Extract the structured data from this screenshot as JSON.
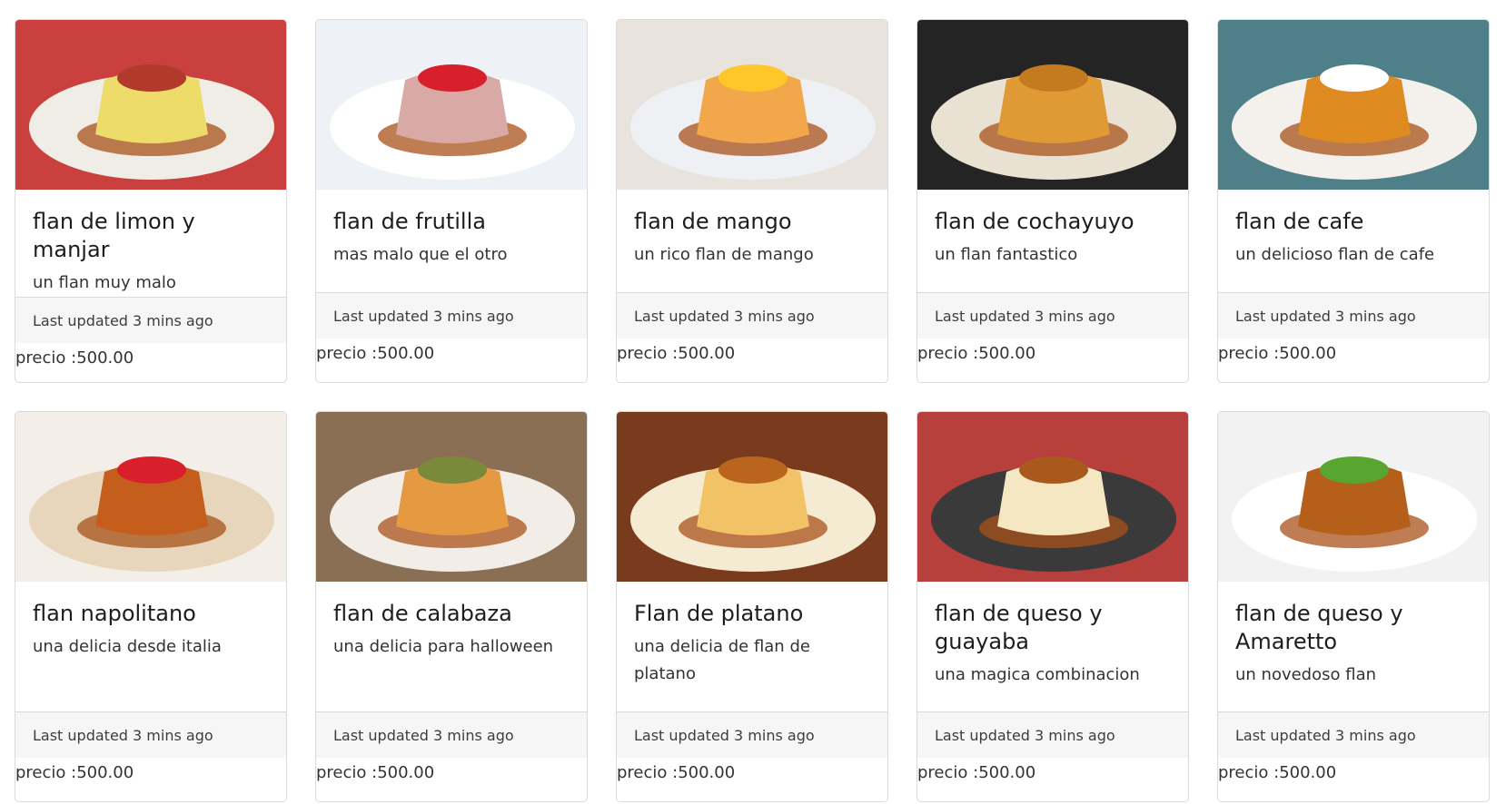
{
  "cards": [
    {
      "title": "flan de limon y manjar",
      "description": "un flan muy malo",
      "updated": "Last updated 3 mins ago",
      "price": "precio :500.00",
      "image": "flan-lemon-photo",
      "colors": {
        "bg": "#c9403e",
        "plate": "#f0ece6",
        "flan": "#eedc6a",
        "top": "#b23a2c"
      }
    },
    {
      "title": "flan de frutilla",
      "description": "mas malo que el otro",
      "updated": "Last updated 3 mins ago",
      "price": "precio :500.00",
      "image": "flan-strawberry-photo",
      "colors": {
        "bg": "#eef1f5",
        "plate": "#ffffff",
        "flan": "#d9a9a6",
        "top": "#d8202c"
      }
    },
    {
      "title": "flan de mango",
      "description": "un rico flan de mango",
      "updated": "Last updated 3 mins ago",
      "price": "precio :500.00",
      "image": "flan-mango-photo",
      "colors": {
        "bg": "#e8e3dc",
        "plate": "#eef0f3",
        "flan": "#f2a84a",
        "top": "#ffc72a"
      }
    },
    {
      "title": "flan de cochayuyo",
      "description": "un flan fantastico",
      "updated": "Last updated 3 mins ago",
      "price": "precio :500.00",
      "image": "flan-cochayuyo-photo",
      "colors": {
        "bg": "#242424",
        "plate": "#e9e2d2",
        "flan": "#e09a35",
        "top": "#c47a1e"
      }
    },
    {
      "title": "flan de cafe",
      "description": "un delicioso flan de cafe",
      "updated": "Last updated 3 mins ago",
      "price": "precio :500.00",
      "image": "flan-coffee-photo",
      "colors": {
        "bg": "#4f7f88",
        "plate": "#f4f1ec",
        "flan": "#e08a22",
        "top": "#ffffff"
      }
    },
    {
      "title": "flan napolitano",
      "description": "una delicia desde italia",
      "updated": "Last updated 3 mins ago",
      "price": "precio :500.00",
      "image": "flan-napolitano-photo",
      "colors": {
        "bg": "#f3efe8",
        "plate": "#e7d6bb",
        "flan": "#c55e1c",
        "top": "#d8202c"
      }
    },
    {
      "title": "flan de calabaza",
      "description": "una delicia para halloween",
      "updated": "Last updated 3 mins ago",
      "price": "precio :500.00",
      "image": "flan-pumpkin-photo",
      "colors": {
        "bg": "#8a6f55",
        "plate": "#f2ede6",
        "flan": "#e59a42",
        "top": "#7a8a3a"
      }
    },
    {
      "title": "Flan de platano",
      "description": "una delicia de flan de platano",
      "updated": "Last updated 3 mins ago",
      "price": "precio :500.00",
      "image": "flan-banana-photo",
      "colors": {
        "bg": "#7a3a1e",
        "plate": "#f5ebd2",
        "flan": "#f1c266",
        "top": "#b9651e"
      }
    },
    {
      "title": "flan de queso y guayaba",
      "description": "una magica combinacion",
      "updated": "Last updated 3 mins ago",
      "price": "precio :500.00",
      "image": "flan-cheese-guava-photo",
      "colors": {
        "bg": "#b8403c",
        "plate": "#3a3a3a",
        "flan": "#f4e7c2",
        "top": "#a9591c"
      }
    },
    {
      "title": "flan de queso y Amaretto",
      "description": "un novedoso flan",
      "updated": "Last updated 3 mins ago",
      "price": "precio :500.00",
      "image": "flan-amaretto-kiwi-photo",
      "colors": {
        "bg": "#f2f2f2",
        "plate": "#ffffff",
        "flan": "#b55f1a",
        "top": "#58a530"
      }
    }
  ]
}
